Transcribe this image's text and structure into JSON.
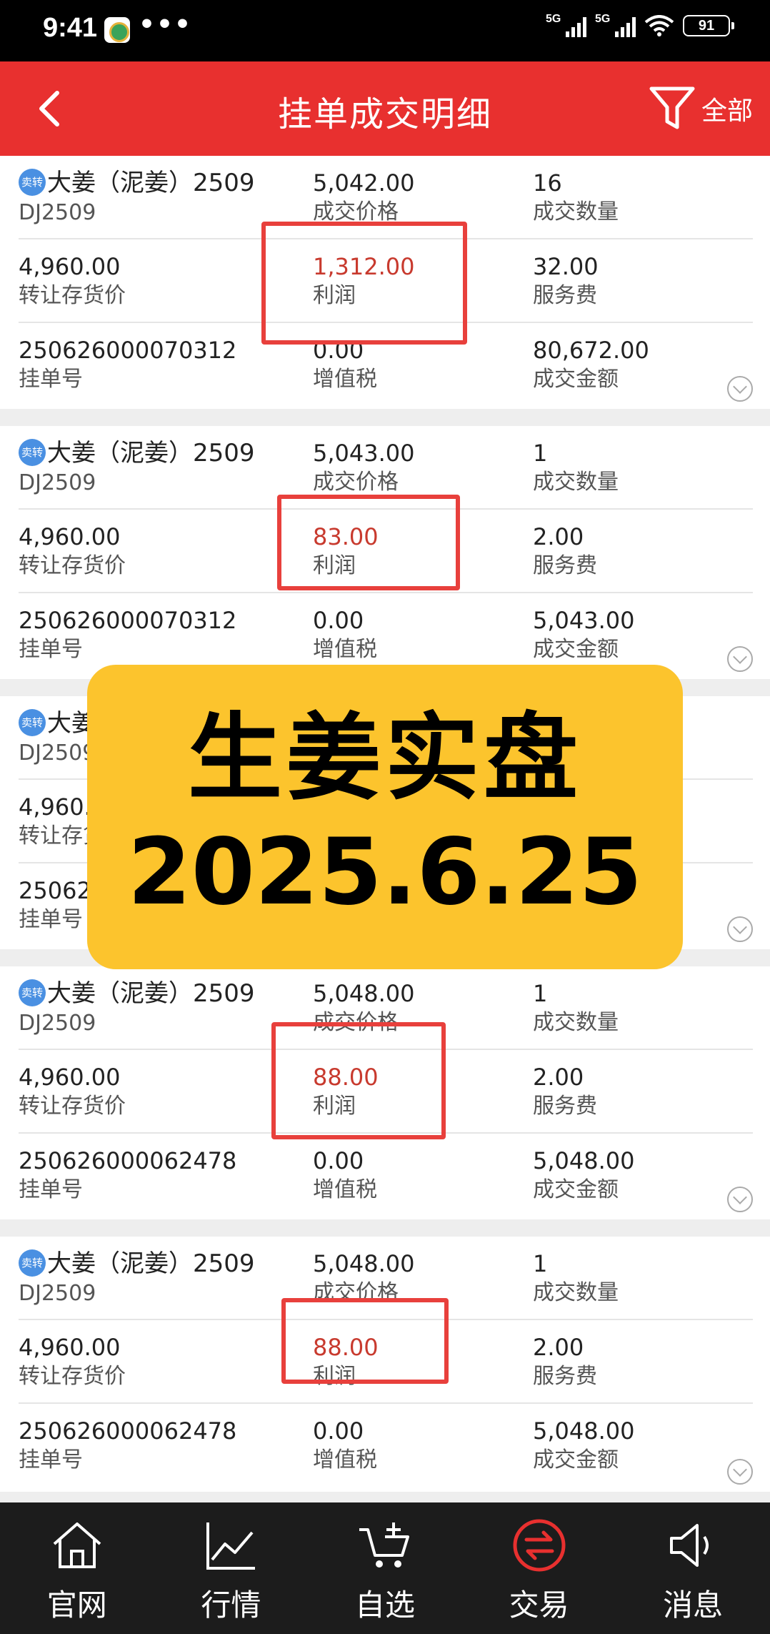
{
  "status": {
    "time": "9:41",
    "dots": "•••",
    "net1": "5G",
    "net2": "5G",
    "battery": "91"
  },
  "header": {
    "title": "挂单成交明细",
    "filter_label": "全部"
  },
  "colors": {
    "brand_red": "#e8302f",
    "profit_red": "#c83a2e",
    "banner_yellow": "#fcc42d",
    "nav_bg": "#1c1c1c"
  },
  "labels": {
    "price": "成交价格",
    "qty": "成交数量",
    "cost": "转让存货价",
    "profit": "利润",
    "fee": "服务费",
    "order_no": "挂单号",
    "vat": "增值税",
    "amount": "成交金额",
    "sell_tag": "卖转"
  },
  "trades": [
    {
      "name": "大姜（泥姜）2509",
      "code": "DJ2509",
      "price": "5,042.00",
      "qty": "16",
      "cost": "4,960.00",
      "profit": "1,312.00",
      "fee": "32.00",
      "order_no": "250626000070312",
      "vat": "0.00",
      "amount": "80,672.00"
    },
    {
      "name": "大姜（泥姜）2509",
      "code": "DJ2509",
      "price": "5,043.00",
      "qty": "1",
      "cost": "4,960.00",
      "profit": "83.00",
      "fee": "2.00",
      "order_no": "250626000070312",
      "vat": "0.00",
      "amount": "5,043.00"
    },
    {
      "name": "大姜（泥姜）2509",
      "code": "DJ2509",
      "price": "",
      "qty": "",
      "cost": "4,960.00",
      "profit": "",
      "fee": "",
      "order_no": "250626000062478",
      "vat": "",
      "amount": ""
    },
    {
      "name": "大姜（泥姜）2509",
      "code": "DJ2509",
      "price": "5,048.00",
      "qty": "1",
      "cost": "4,960.00",
      "profit": "88.00",
      "fee": "2.00",
      "order_no": "250626000062478",
      "vat": "0.00",
      "amount": "5,048.00"
    },
    {
      "name": "大姜（泥姜）2509",
      "code": "DJ2509",
      "price": "5,048.00",
      "qty": "1",
      "cost": "4,960.00",
      "profit": "88.00",
      "fee": "2.00",
      "order_no": "250626000062478",
      "vat": "0.00",
      "amount": "5,048.00"
    }
  ],
  "banner": {
    "line1": "生姜实盘",
    "line2": "2025.6.25"
  },
  "nav": [
    {
      "label": "官网",
      "icon": "home-icon"
    },
    {
      "label": "行情",
      "icon": "chart-icon"
    },
    {
      "label": "自选",
      "icon": "cart-add-icon"
    },
    {
      "label": "交易",
      "icon": "exchange-icon"
    },
    {
      "label": "消息",
      "icon": "speaker-icon"
    }
  ]
}
